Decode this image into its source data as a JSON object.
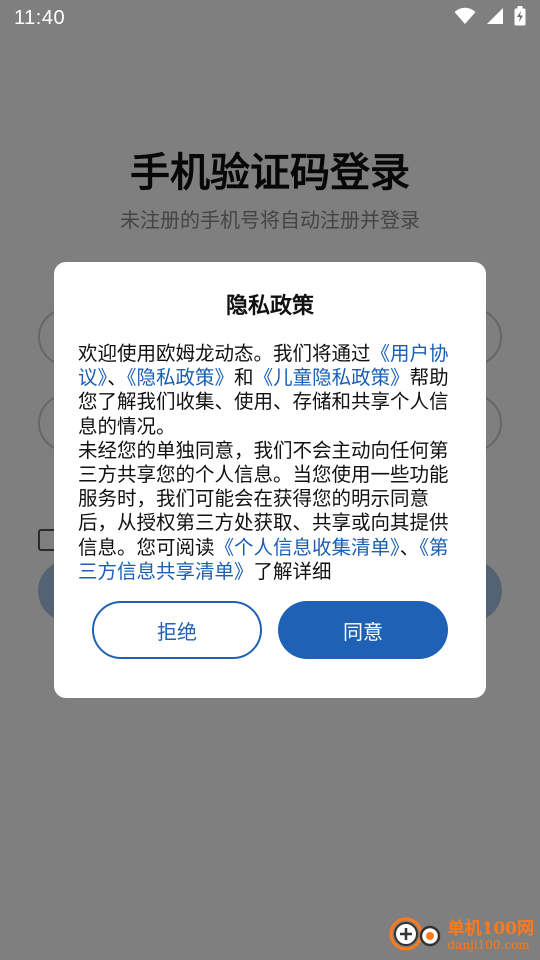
{
  "status_bar": {
    "time": "11:40",
    "icons": [
      "wifi-icon",
      "signal-icon",
      "battery-icon"
    ]
  },
  "login_page": {
    "title": "手机验证码登录",
    "subtitle": "未注册的手机号将自动注册并登录"
  },
  "dialog": {
    "title": "隐私政策",
    "p1_intro": "欢迎使用欧姆龙动态。我们将通过",
    "p1_link_user": "《用户协议》",
    "p1_sep": "、",
    "p1_link_privacy": "《隐私政策》",
    "p1_and": "和",
    "p1_link_child": "《儿童隐私政策》",
    "p1_rest": "帮助您了解我们收集、使用、存储和共享个人信息的情况。",
    "p2_text": "未经您的单独同意，我们不会主动向任何第三方共享您的个人信息。当您使用一些功能服务时，我们可能会在获得您的明示同意后，从授权第三方处获取、共享或向其提供信息。您可阅读",
    "p2_link_collect": "《个人信息收集清单》",
    "p2_sep": "、",
    "p2_link_third": "《第三方信息共享清单》",
    "p2_rest": "了解详细",
    "reject_label": "拒绝",
    "agree_label": "同意"
  },
  "colors": {
    "primary": "#1f62b5",
    "link": "#1a5fb4",
    "watermark": "#ff7a1a"
  },
  "watermark": {
    "name": "单机100网",
    "url": "danji100.com"
  }
}
